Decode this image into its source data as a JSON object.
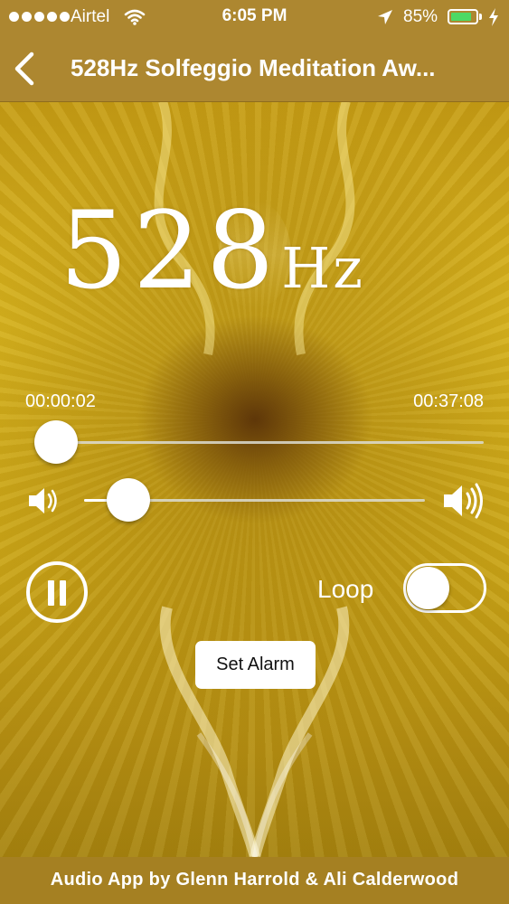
{
  "status_bar": {
    "carrier": "Airtel",
    "time": "6:05 PM",
    "battery_percent": "85%",
    "battery_level": 0.85,
    "icons": [
      "signal-dots",
      "wifi-icon",
      "location-icon",
      "battery-icon",
      "charging-icon"
    ]
  },
  "nav": {
    "back_icon": "chevron-left-icon",
    "title": "528Hz Solfeggio Meditation Aw..."
  },
  "frequency": {
    "number": "528",
    "unit": "Hz"
  },
  "playback": {
    "elapsed": "00:00:02",
    "total": "00:37:08",
    "progress": 0.02
  },
  "volume": {
    "level": 0.13,
    "low_icon": "volume-low-icon",
    "high_icon": "volume-high-icon"
  },
  "controls": {
    "pause_icon": "pause-icon",
    "loop_label": "Loop",
    "loop_on": false,
    "alarm_label": "Set Alarm"
  },
  "footer": {
    "credit": "Audio App by Glenn Harrold & Ali Calderwood"
  },
  "colors": {
    "bar_background": "#ad8730",
    "footer_background": "#a58022",
    "battery_fill": "#4cd964",
    "text": "#ffffff"
  }
}
